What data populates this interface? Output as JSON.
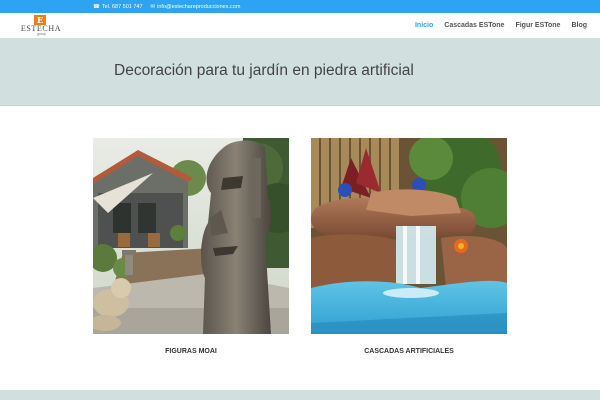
{
  "topbar": {
    "phone": "Tel. 687 501 747",
    "email": "info@estechareproducciones.com",
    "phone_icon": "phone-icon",
    "email_icon": "envelope-icon"
  },
  "logo": {
    "badge": "E",
    "name": "ESTECHA",
    "sub": "group"
  },
  "nav": {
    "items": [
      "Inicio",
      "Cascadas ESTone",
      "Figur ESTone",
      "Blog"
    ],
    "active": "Inicio"
  },
  "hero": {
    "title": "Decoración para tu jardín en piedra artificial"
  },
  "cards": [
    {
      "caption": "FIGURAS MOAI"
    },
    {
      "caption": "CASCADAS ARTIFICIALES"
    }
  ],
  "colors": {
    "accent": "#2ea3f2",
    "hero_bg": "#d1dfdf",
    "logo": "#e8821e"
  }
}
